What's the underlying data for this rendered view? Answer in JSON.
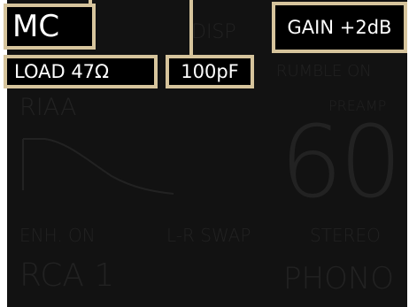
{
  "display": {
    "highlighted": {
      "cartridge": "MC",
      "gain": "GAIN +2dB",
      "load": "LOAD 47Ω",
      "capacitance": "100pF"
    },
    "dimmed": {
      "disp": "DISP",
      "rumble": "RUMBLE ON",
      "riaa": "RIAA",
      "preamp": "PREAMP",
      "volume": "60",
      "enhance": "ENH. ON",
      "swap": "L-R SWAP",
      "mode": "STEREO",
      "input": "RCA 1",
      "source": "PHONO"
    }
  },
  "colors": {
    "screen_background": "#121212",
    "dim_text": "#222222",
    "callout_border": "#d6c49c",
    "callout_background": "#000000",
    "callout_text": "#ffffff"
  },
  "icons": {
    "riaa_curve": "riaa-curve-icon"
  }
}
